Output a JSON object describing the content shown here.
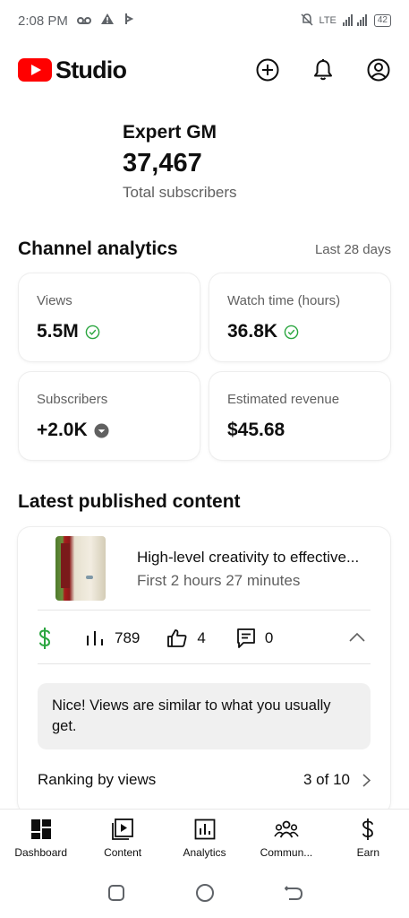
{
  "status_bar": {
    "time": "2:08 PM",
    "battery": "42",
    "network": "LTE"
  },
  "header": {
    "app_name": "Studio",
    "brand_color": "#ff0000",
    "icons": [
      "create-icon",
      "bell-icon",
      "account-icon"
    ]
  },
  "channel": {
    "name": "Expert GM",
    "subscribers": "37,467",
    "subscribers_label": "Total subscribers"
  },
  "analytics": {
    "title": "Channel analytics",
    "period": "Last 28 days",
    "cards": [
      {
        "label": "Views",
        "value": "5.5M",
        "indicator": "check-circle-icon"
      },
      {
        "label": "Watch time (hours)",
        "value": "36.8K",
        "indicator": "check-circle-icon"
      },
      {
        "label": "Subscribers",
        "value": "+2.0K",
        "indicator": "arrow-down-circle-icon"
      },
      {
        "label": "Estimated revenue",
        "value": "$45.68",
        "indicator": ""
      }
    ],
    "check_color": "#2ba640"
  },
  "latest": {
    "title": "Latest published content",
    "video_title": "High-level creativity to effective...",
    "published": "First 2 hours 27 minutes",
    "views": "789",
    "likes": "4",
    "comments": "0",
    "monetization_color": "#2ba640",
    "notice": "Nice! Views are similar to what you usually get.",
    "ranking_label": "Ranking by views",
    "ranking_value": "3 of 10"
  },
  "bottom_nav": [
    {
      "label": "Dashboard",
      "icon": "dashboard-icon"
    },
    {
      "label": "Content",
      "icon": "content-icon"
    },
    {
      "label": "Analytics",
      "icon": "analytics-icon"
    },
    {
      "label": "Commun...",
      "icon": "community-icon"
    },
    {
      "label": "Earn",
      "icon": "earn-icon"
    }
  ]
}
